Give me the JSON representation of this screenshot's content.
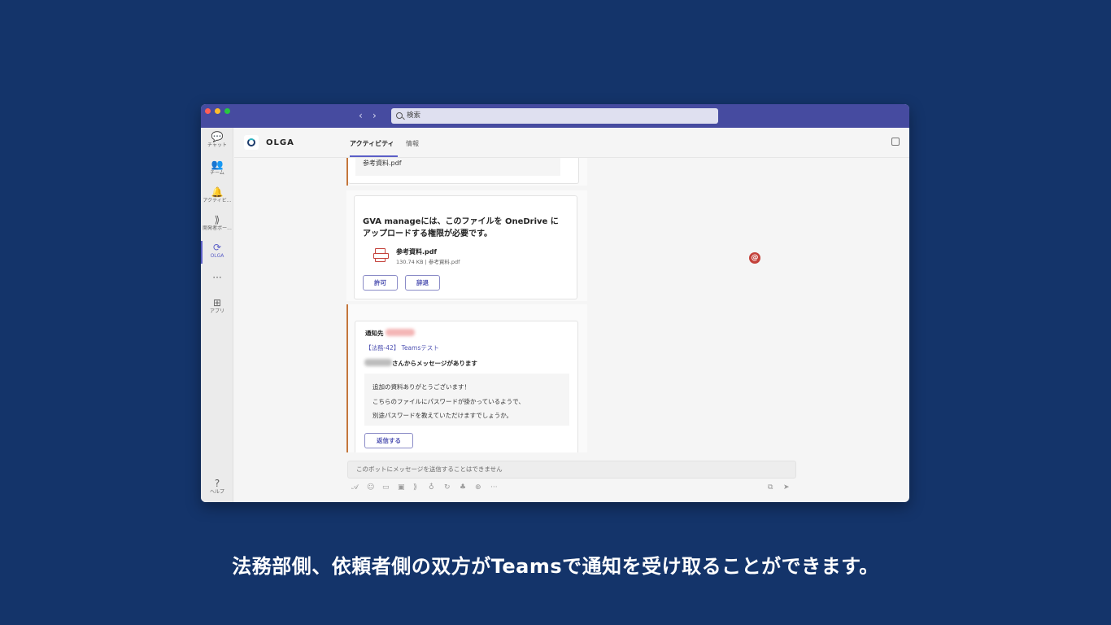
{
  "window": {
    "search_placeholder": "検索",
    "nav_back": "‹",
    "nav_forward": "›"
  },
  "rail": {
    "items": [
      {
        "label": "チャット",
        "icon": "chat-icon",
        "glyph": "💬"
      },
      {
        "label": "チーム",
        "icon": "teams-icon",
        "glyph": "👥"
      },
      {
        "label": "アクティビ...",
        "icon": "bell-icon",
        "glyph": "🔔"
      },
      {
        "label": "開発者ポー...",
        "icon": "developer-portal-icon",
        "glyph": "⟫"
      },
      {
        "label": "OLGA",
        "icon": "olga-app-icon",
        "glyph": "⟳"
      },
      {
        "label": "",
        "icon": "more-icon",
        "glyph": "···"
      },
      {
        "label": "アプリ",
        "icon": "apps-icon",
        "glyph": "⊞"
      },
      {
        "label": "ヘルプ",
        "icon": "help-icon",
        "glyph": "?"
      }
    ]
  },
  "app": {
    "name": "OLGA",
    "tabs": [
      {
        "label": "アクティビティ",
        "active": true
      },
      {
        "label": "情報",
        "active": false
      }
    ]
  },
  "feed": {
    "prev_file_name": "参考資料.pdf",
    "permission_card": {
      "title_line1": "GVA manageには、このファイルを OneDrive に",
      "title_line2": "アップロードする権限が必要です。",
      "file_name": "参考資料.pdf",
      "file_meta": "130.74 KB | 参考資料.pdf",
      "allow_label": "許可",
      "decline_label": "辞退"
    },
    "mention_badge": "@",
    "notification_card": {
      "notify_to_label": "通知先",
      "case_link": "【法務-42】 Teamsテスト",
      "from_suffix": "さんからメッセージがあります",
      "quote_lines": [
        "追加の資料ありがとうございます！",
        "こちらのファイルにパスワードが掛かっているようで、",
        "別途パスワードを教えていただけますでしょうか。"
      ],
      "reply_label": "返信する"
    }
  },
  "compose": {
    "placeholder": "このボットにメッセージを送信することはできません"
  },
  "caption": "法務部側、依頼者側の双方がTeamsで通知を受け取ることができます。",
  "colors": {
    "background": "#14346a",
    "titlebar": "#464ba0",
    "accent": "#5b5fc7",
    "message_accent": "#c4763b",
    "mention_badge": "#c4423b"
  }
}
